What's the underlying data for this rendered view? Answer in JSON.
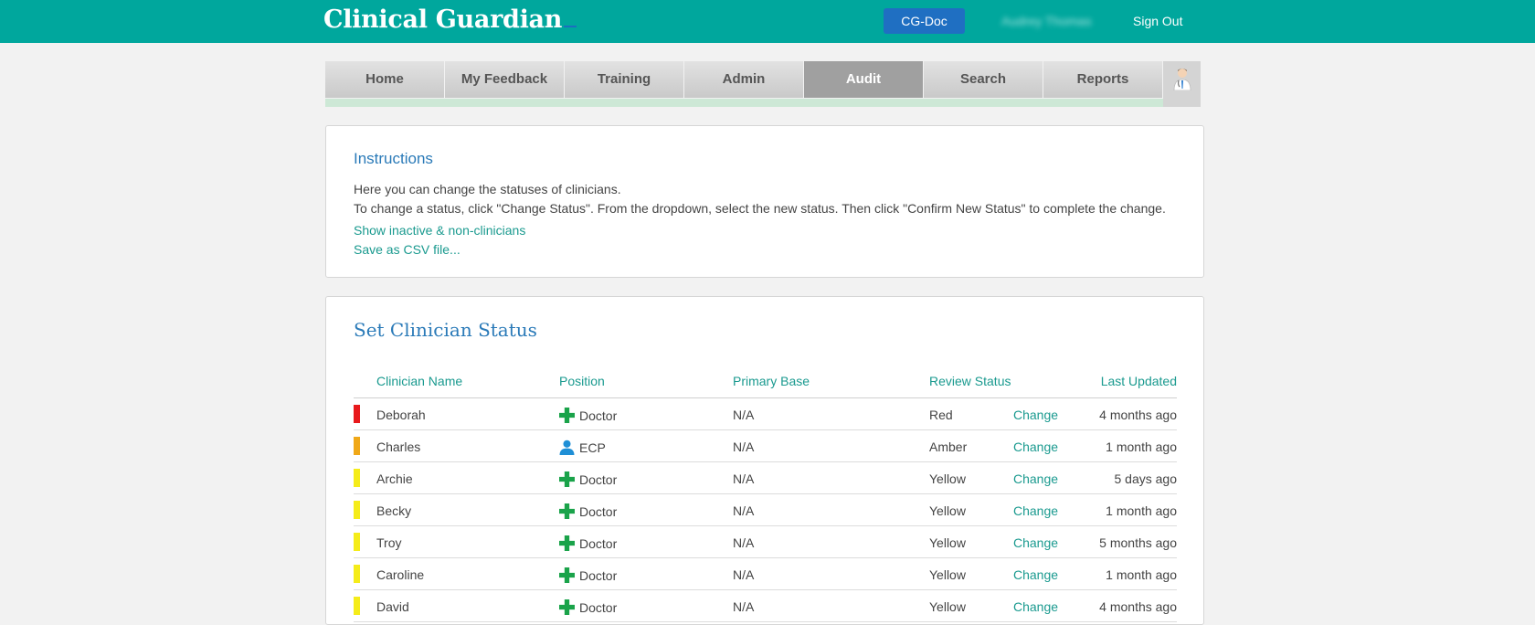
{
  "app": {
    "brand": "Clinical Guardian",
    "cg_doc_label": "CG-Doc",
    "user_name": "Audrey Thomas",
    "signout_label": "Sign Out"
  },
  "nav": {
    "tabs": [
      {
        "label": "Home",
        "active": false
      },
      {
        "label": "My Feedback",
        "active": false
      },
      {
        "label": "Training",
        "active": false
      },
      {
        "label": "Admin",
        "active": false
      },
      {
        "label": "Audit",
        "active": true
      },
      {
        "label": "Search",
        "active": false
      },
      {
        "label": "Reports",
        "active": false
      }
    ],
    "avatar_icon": "doctor-avatar-icon"
  },
  "instructions": {
    "title": "Instructions",
    "line1": "Here you can change the statuses of clinicians.",
    "line2": "To change a status, click \"Change Status\". From the dropdown, select the new status. Then click \"Confirm New Status\" to complete the change.",
    "link_inactive": "Show inactive & non-clinicians",
    "link_csv": "Save as CSV file..."
  },
  "status_panel": {
    "title": "Set Clinician Status",
    "columns": {
      "name": "Clinician Name",
      "position": "Position",
      "base": "Primary Base",
      "review": "Review Status",
      "updated": "Last Updated"
    },
    "change_label": "Change",
    "rows": [
      {
        "flag": "#e8191c",
        "name": "Deborah",
        "position": "Doctor",
        "position_icon": "plus-cross-icon",
        "base": "N/A",
        "status": "Red",
        "updated": "4 months ago"
      },
      {
        "flag": "#f0a818",
        "name": "Charles",
        "position": "ECP",
        "position_icon": "person-icon",
        "base": "N/A",
        "status": "Amber",
        "updated": "1 month ago"
      },
      {
        "flag": "#f5ec1a",
        "name": "Archie",
        "position": "Doctor",
        "position_icon": "plus-cross-icon",
        "base": "N/A",
        "status": "Yellow",
        "updated": "5 days ago"
      },
      {
        "flag": "#f5ec1a",
        "name": "Becky",
        "position": "Doctor",
        "position_icon": "plus-cross-icon",
        "base": "N/A",
        "status": "Yellow",
        "updated": "1 month ago"
      },
      {
        "flag": "#f5ec1a",
        "name": "Troy",
        "position": "Doctor",
        "position_icon": "plus-cross-icon",
        "base": "N/A",
        "status": "Yellow",
        "updated": "5 months ago"
      },
      {
        "flag": "#f5ec1a",
        "name": "Caroline",
        "position": "Doctor",
        "position_icon": "plus-cross-icon",
        "base": "N/A",
        "status": "Yellow",
        "updated": "1 month ago"
      },
      {
        "flag": "#f5ec1a",
        "name": "David",
        "position": "Doctor",
        "position_icon": "plus-cross-icon",
        "base": "N/A",
        "status": "Yellow",
        "updated": "4 months ago"
      }
    ]
  },
  "colors": {
    "header": "#00a79d",
    "link": "#1a9a8f",
    "title": "#2a7ab8",
    "doctor_icon": "#1aa34a",
    "ecp_icon": "#1f8fd6"
  }
}
